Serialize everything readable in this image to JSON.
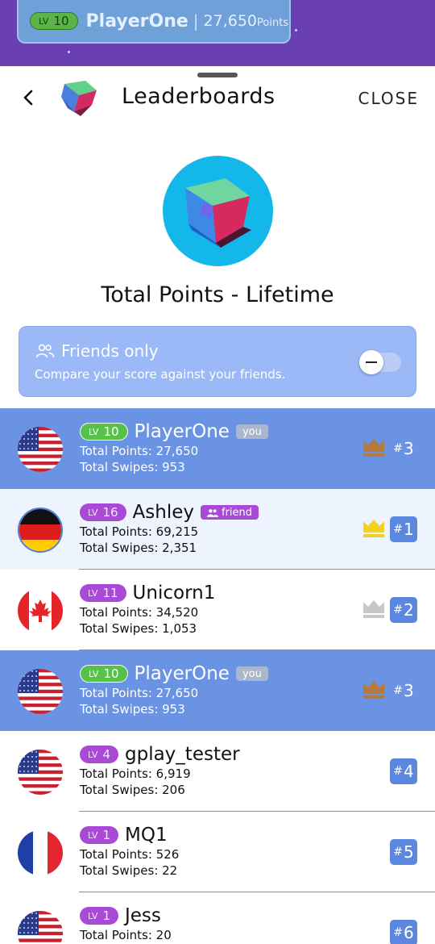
{
  "header": {
    "level_label": "LV",
    "level": "10",
    "player_name": "PlayerOne",
    "separator": "|",
    "points": "27,650",
    "points_unit": "Points"
  },
  "sheet": {
    "title": "Leaderboards",
    "close_label": "CLOSE",
    "board_title": "Total Points - Lifetime"
  },
  "friends_filter": {
    "title": "Friends only",
    "subtitle": "Compare your score against your friends.",
    "enabled": false
  },
  "colors": {
    "purple": "#6a3fb2",
    "highlight_row": "#6a93e3",
    "rank_box": "#5b88de",
    "crown_gold": "#f3d11c",
    "crown_silver": "#c7c7c7",
    "crown_bronze": "#b87a3a"
  },
  "rows": [
    {
      "flag": "usa",
      "lv_label": "LV",
      "lv": "10",
      "lv_style": "greenlight",
      "name": "PlayerOne",
      "tag": "you",
      "points_label": "Total Points: 27,650",
      "swipes_label": "Total Swipes: 953",
      "rank_hash": "#",
      "rank": "3",
      "crown": "bronze",
      "style": "me"
    },
    {
      "flag": "germany",
      "lv_label": "LV",
      "lv": "16",
      "lv_style": "purple",
      "name": "Ashley",
      "tag": "friend",
      "points_label": "Total Points: 69,215",
      "swipes_label": "Total Swipes: 2,351",
      "rank_hash": "#",
      "rank": "1",
      "crown": "gold",
      "style": "alt"
    },
    {
      "flag": "canada",
      "lv_label": "LV",
      "lv": "11",
      "lv_style": "purple",
      "name": "Unicorn1",
      "tag": "",
      "points_label": "Total Points: 34,520",
      "swipes_label": "Total Swipes: 1,053",
      "rank_hash": "#",
      "rank": "2",
      "crown": "silver",
      "style": "plain"
    },
    {
      "flag": "usa",
      "lv_label": "LV",
      "lv": "10",
      "lv_style": "greenlight",
      "name": "PlayerOne",
      "tag": "you",
      "points_label": "Total Points: 27,650",
      "swipes_label": "Total Swipes: 953",
      "rank_hash": "#",
      "rank": "3",
      "crown": "bronze",
      "style": "me"
    },
    {
      "flag": "usa",
      "lv_label": "LV",
      "lv": "4",
      "lv_style": "purple",
      "name": "gplay_tester",
      "tag": "",
      "points_label": "Total Points: 6,919",
      "swipes_label": "Total Swipes: 206",
      "rank_hash": "#",
      "rank": "4",
      "crown": "",
      "style": "plain"
    },
    {
      "flag": "france",
      "lv_label": "LV",
      "lv": "1",
      "lv_style": "purple",
      "name": "MQ1",
      "tag": "",
      "points_label": "Total Points: 526",
      "swipes_label": "Total Swipes: 22",
      "rank_hash": "#",
      "rank": "5",
      "crown": "",
      "style": "plain"
    },
    {
      "flag": "usa",
      "lv_label": "LV",
      "lv": "1",
      "lv_style": "purple",
      "name": "Jess",
      "tag": "",
      "points_label": "Total Points: 20",
      "swipes_label": "",
      "rank_hash": "#",
      "rank": "6",
      "crown": "",
      "style": "plain"
    }
  ]
}
